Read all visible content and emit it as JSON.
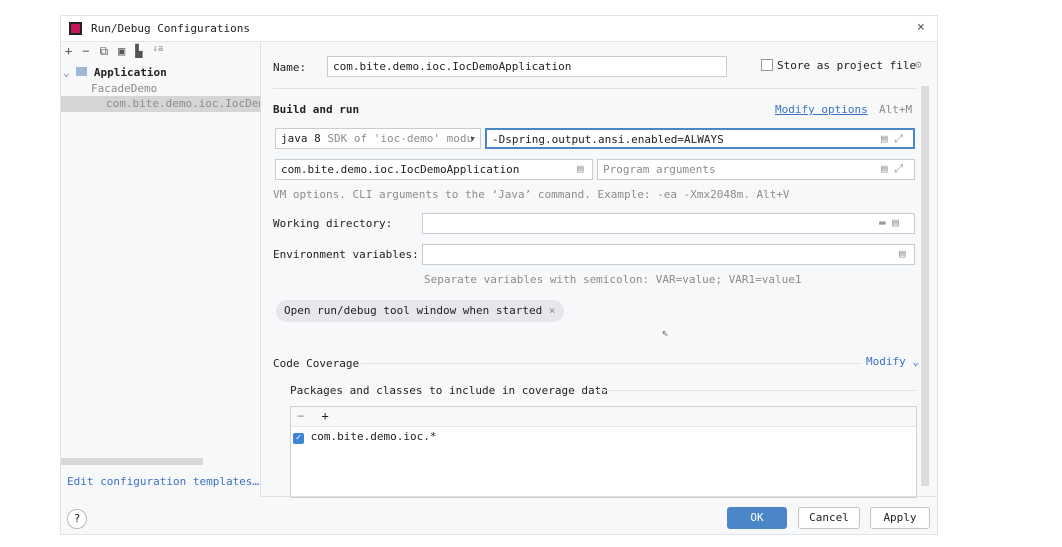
{
  "window": {
    "title": "Run/Debug Configurations",
    "close": "×"
  },
  "toolbar": {
    "add": "+",
    "remove": "−",
    "copy": "⧉",
    "save": "▣",
    "folder": "▙",
    "sort": "↓a"
  },
  "tree": {
    "group": "Application",
    "items": [
      "FacadeDemo",
      "com.bite.demo.ioc.IocDem"
    ]
  },
  "edit_templates": "Edit configuration templates…",
  "name_label": "Name:",
  "name_value": "com.bite.demo.ioc.IocDemoApplication",
  "store_label": "Store as project file",
  "build": {
    "title": "Build and run",
    "modify": "Modify options",
    "shortcut": "Alt+M",
    "jdk": "java 8",
    "jdk_hint": "SDK of 'ioc-demo' modu",
    "vm_options": "-Dspring.output.ansi.enabled=ALWAYS",
    "main_class": "com.bite.demo.ioc.IocDemoApplication",
    "program_args_placeholder": "Program arguments",
    "hint": "VM options. CLI arguments to the ‘Java’ command. Example: -ea -Xmx2048m. Alt+V"
  },
  "workdir_label": "Working directory:",
  "env_label": "Environment variables:",
  "env_hint": "Separate variables with semicolon: VAR=value; VAR1=value1",
  "chip": "Open run/debug tool window when started",
  "coverage": {
    "title": "Code Coverage",
    "modify": "Modify",
    "packages_title": "Packages and classes to include in coverage data",
    "minus": "−",
    "plus": "+",
    "items": [
      {
        "label": "com.bite.demo.ioc.*",
        "checked": true
      }
    ]
  },
  "footer": {
    "help": "?",
    "ok": "OK",
    "cancel": "Cancel",
    "apply": "Apply"
  },
  "colors": {
    "accent": "#3d72c2",
    "ok_button": "#4a86c8"
  }
}
